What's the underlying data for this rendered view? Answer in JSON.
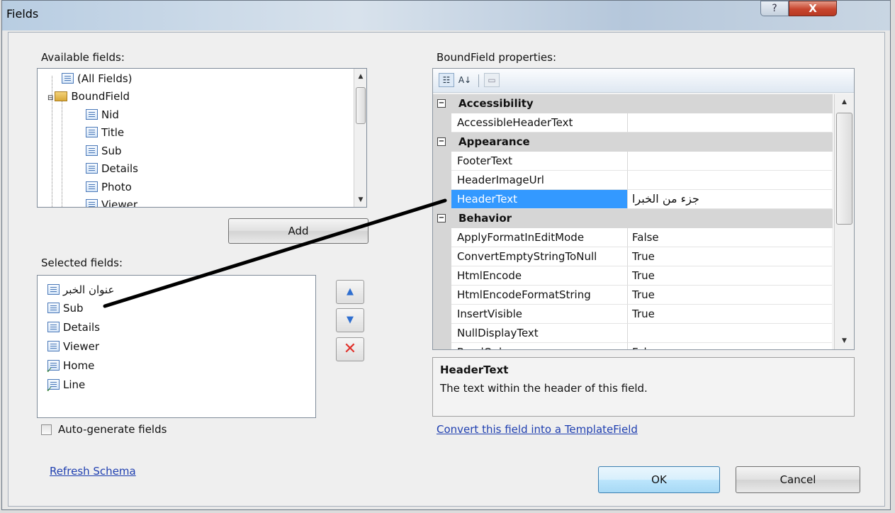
{
  "window": {
    "title": "Fields",
    "help_glyph": "?",
    "close_glyph": "X"
  },
  "available": {
    "label": "Available fields:",
    "items": [
      "(All Fields)",
      "BoundField",
      "Nid",
      "Title",
      "Sub",
      "Details",
      "Photo",
      "Viewer"
    ],
    "add_button": "Add"
  },
  "selected": {
    "label": "Selected fields:",
    "items": [
      "عنوان الخبر",
      "Sub",
      "Details",
      "Viewer",
      "Home",
      "Line"
    ],
    "move_up_glyph": "▲",
    "move_down_glyph": "▼",
    "delete_glyph": "✕"
  },
  "auto_generate": {
    "label": "Auto-generate fields",
    "checked": false
  },
  "refresh_schema": "Refresh Schema",
  "properties": {
    "label": "BoundField properties:",
    "toolbar": {
      "categorized": "☷",
      "alphabetical": "A↓",
      "property_pages": "▭"
    },
    "categories": [
      {
        "name": "Accessibility",
        "rows": [
          {
            "name": "AccessibleHeaderText",
            "value": ""
          }
        ]
      },
      {
        "name": "Appearance",
        "rows": [
          {
            "name": "FooterText",
            "value": ""
          },
          {
            "name": "HeaderImageUrl",
            "value": ""
          },
          {
            "name": "HeaderText",
            "value": "جزء من الخبرا"
          }
        ]
      },
      {
        "name": "Behavior",
        "rows": [
          {
            "name": "ApplyFormatInEditMode",
            "value": "False"
          },
          {
            "name": "ConvertEmptyStringToNull",
            "value": "True"
          },
          {
            "name": "HtmlEncode",
            "value": "True"
          },
          {
            "name": "HtmlEncodeFormatString",
            "value": "True"
          },
          {
            "name": "InsertVisible",
            "value": "True"
          },
          {
            "name": "NullDisplayText",
            "value": ""
          },
          {
            "name": "ReadOnly",
            "value": "False"
          }
        ]
      }
    ],
    "selected_property": "HeaderText",
    "description_title": "HeaderText",
    "description_text": "The text within the header of this field."
  },
  "convert_link": "Convert this field into a TemplateField",
  "ok_button": "OK",
  "cancel_button": "Cancel",
  "colors": {
    "selection": "#3399ff",
    "category_bg": "#d6d6d6",
    "link": "#1f3fb0",
    "close_button": "#c7452e"
  }
}
